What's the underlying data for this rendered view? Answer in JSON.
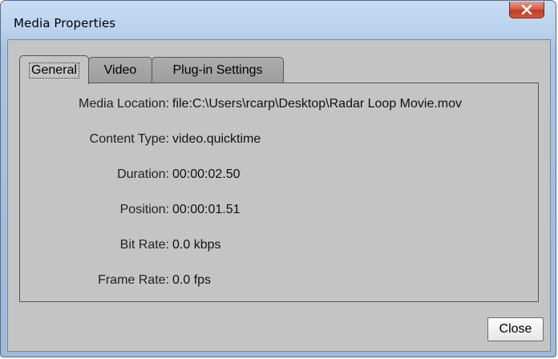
{
  "window": {
    "title": "Media Properties"
  },
  "tabs": [
    {
      "label": "General",
      "active": true
    },
    {
      "label": "Video",
      "active": false
    },
    {
      "label": "Plug-in Settings",
      "active": false
    }
  ],
  "properties": [
    {
      "label": "Media Location:",
      "value": "file:C:\\Users\\rcarp\\Desktop\\Radar Loop Movie.mov"
    },
    {
      "label": "Content Type:",
      "value": "video.quicktime"
    },
    {
      "label": "Duration:",
      "value": "00:00:02.50"
    },
    {
      "label": "Position:",
      "value": "00:00:01.51"
    },
    {
      "label": "Bit Rate:",
      "value": "0.0 kbps"
    },
    {
      "label": "Frame Rate:",
      "value": "0.0 fps"
    }
  ],
  "buttons": {
    "close_label": "Close"
  },
  "colors": {
    "titlebar_close": "#c7432b",
    "client_bg": "#c4c4c4",
    "inactive_tab": "#a3a3a3"
  }
}
